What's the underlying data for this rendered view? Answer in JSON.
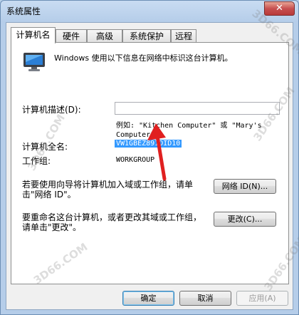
{
  "window": {
    "title": "系统属性",
    "close_symbol": "✕"
  },
  "tabs": [
    {
      "label": "计算机名",
      "active": true
    },
    {
      "label": "硬件",
      "active": false
    },
    {
      "label": "高级",
      "active": false
    },
    {
      "label": "系统保护",
      "active": false
    },
    {
      "label": "远程",
      "active": false
    }
  ],
  "panel": {
    "intro": "Windows 使用以下信息在网络中标识这台计算机。",
    "description_label": "计算机描述(D):",
    "description_value": "",
    "example_line1": "例如: \"Kitchen Computer\" 或 \"Mary's",
    "example_line2": "Computer\"。",
    "full_name_label": "计算机全名:",
    "full_name_value": "VW1GBEZ891DID10",
    "workgroup_label": "工作组:",
    "workgroup_value": "WORKGROUP",
    "wizard_text_line1": "若要使用向导将计算机加入域或工作组，请单",
    "wizard_text_line2": "击\"网络 ID\"。",
    "network_id_button": "网络 ID(N)...",
    "rename_text_line1": "要重命名这台计算机，或者更改其域或工作组，",
    "rename_text_line2": "请单击\"更改\"。",
    "change_button": "更改(C)..."
  },
  "footer": {
    "ok": "确定",
    "cancel": "取消",
    "apply": "应用(A)"
  },
  "watermarks": [
    "3D66.COM",
    "3D66.COM",
    "3D66.COM",
    "3D66.COM",
    "3D66.COM"
  ],
  "colors": {
    "selection": "#3399ff",
    "arrow": "#e02020"
  },
  "icons": {
    "monitor": "computer-monitor-icon"
  }
}
